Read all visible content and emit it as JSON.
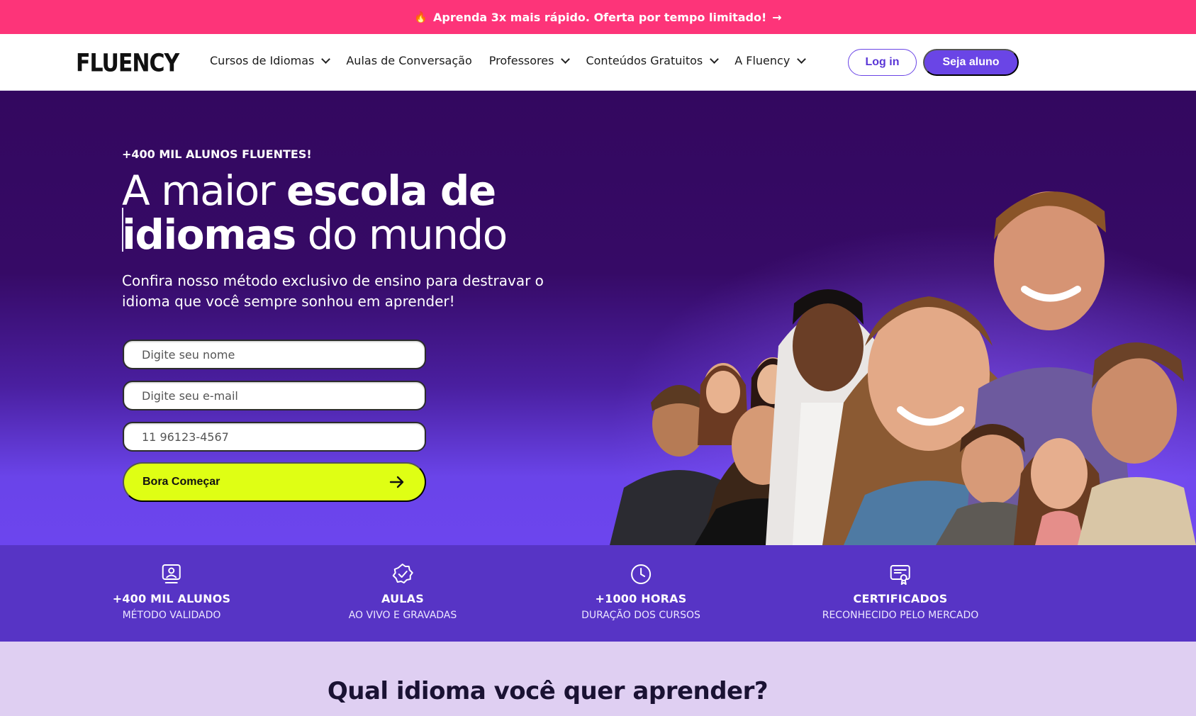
{
  "promo": {
    "emoji": "🔥",
    "text": "Aprenda 3x mais rápido. Oferta por tempo limitado!",
    "arrow": "→"
  },
  "header": {
    "logo": "FLUENCY",
    "nav": [
      {
        "label": "Cursos de Idiomas",
        "dropdown": true
      },
      {
        "label": "Aulas de Conversação",
        "dropdown": false
      },
      {
        "label": "Professores",
        "dropdown": true
      },
      {
        "label": "Conteúdos Gratuitos",
        "dropdown": true
      },
      {
        "label": "A Fluency",
        "dropdown": true
      }
    ],
    "login_label": "Log in",
    "join_label": "Seja aluno"
  },
  "hero": {
    "kicker": "+400 MIL ALUNOS FLUENTES!",
    "headline_part1": "A maior ",
    "headline_bold1": "escola de",
    "headline_bold2": "idiomas",
    "headline_part2": " do mundo",
    "subtitle": "Confira nosso método exclusivo de ensino para destravar o idioma que você sempre sonhou em aprender!",
    "form": {
      "name_placeholder": "Digite seu nome",
      "email_placeholder": "Digite seu e-mail",
      "phone_placeholder": "11 96123-4567",
      "submit_label": "Bora Começar"
    }
  },
  "stats": [
    {
      "icon": "student-monitor-icon",
      "title": "+400 MIL ALUNOS",
      "subtitle": "MÉTODO VALIDADO"
    },
    {
      "icon": "verified-badge-icon",
      "title": "AULAS",
      "subtitle": "AO VIVO E GRAVADAS"
    },
    {
      "icon": "clock-icon",
      "title": "+1000 HORAS",
      "subtitle": "DURAÇÃO DOS CURSOS"
    },
    {
      "icon": "certificate-icon",
      "title": "CERTIFICADOS",
      "subtitle": "RECONHECIDO PELO MERCADO"
    }
  ],
  "section": {
    "title": "Qual idioma você quer aprender?"
  },
  "colors": {
    "promo": "#fd3479",
    "brand_purple": "#6a45e6",
    "hero_top": "#33085f",
    "cta": "#dfff14",
    "stats_bg": "#5734c5",
    "lower_bg": "#dfcff2"
  }
}
